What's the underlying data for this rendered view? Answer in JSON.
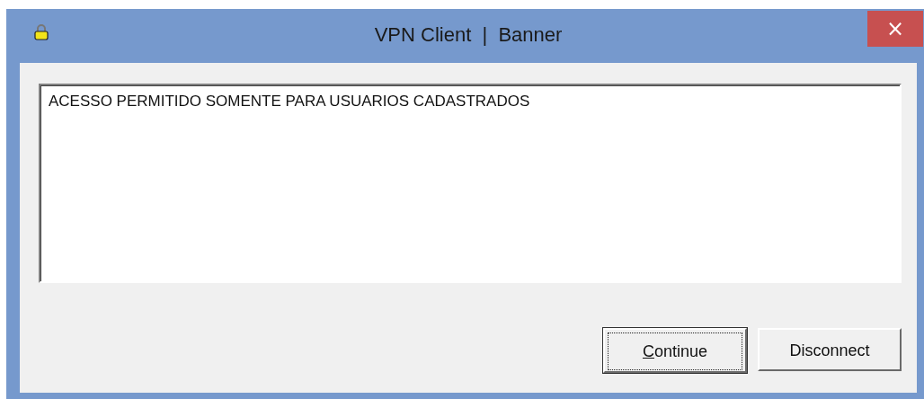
{
  "window": {
    "title": "VPN Client  |  Banner",
    "close": "×"
  },
  "banner": {
    "text": "ACESSO PERMITIDO SOMENTE PARA USUARIOS CADASTRADOS"
  },
  "buttons": [
    {
      "label": "Continue",
      "mnemonic_underlined": true,
      "focused": true
    },
    {
      "label": "Disconnect",
      "focused": false
    }
  ]
}
